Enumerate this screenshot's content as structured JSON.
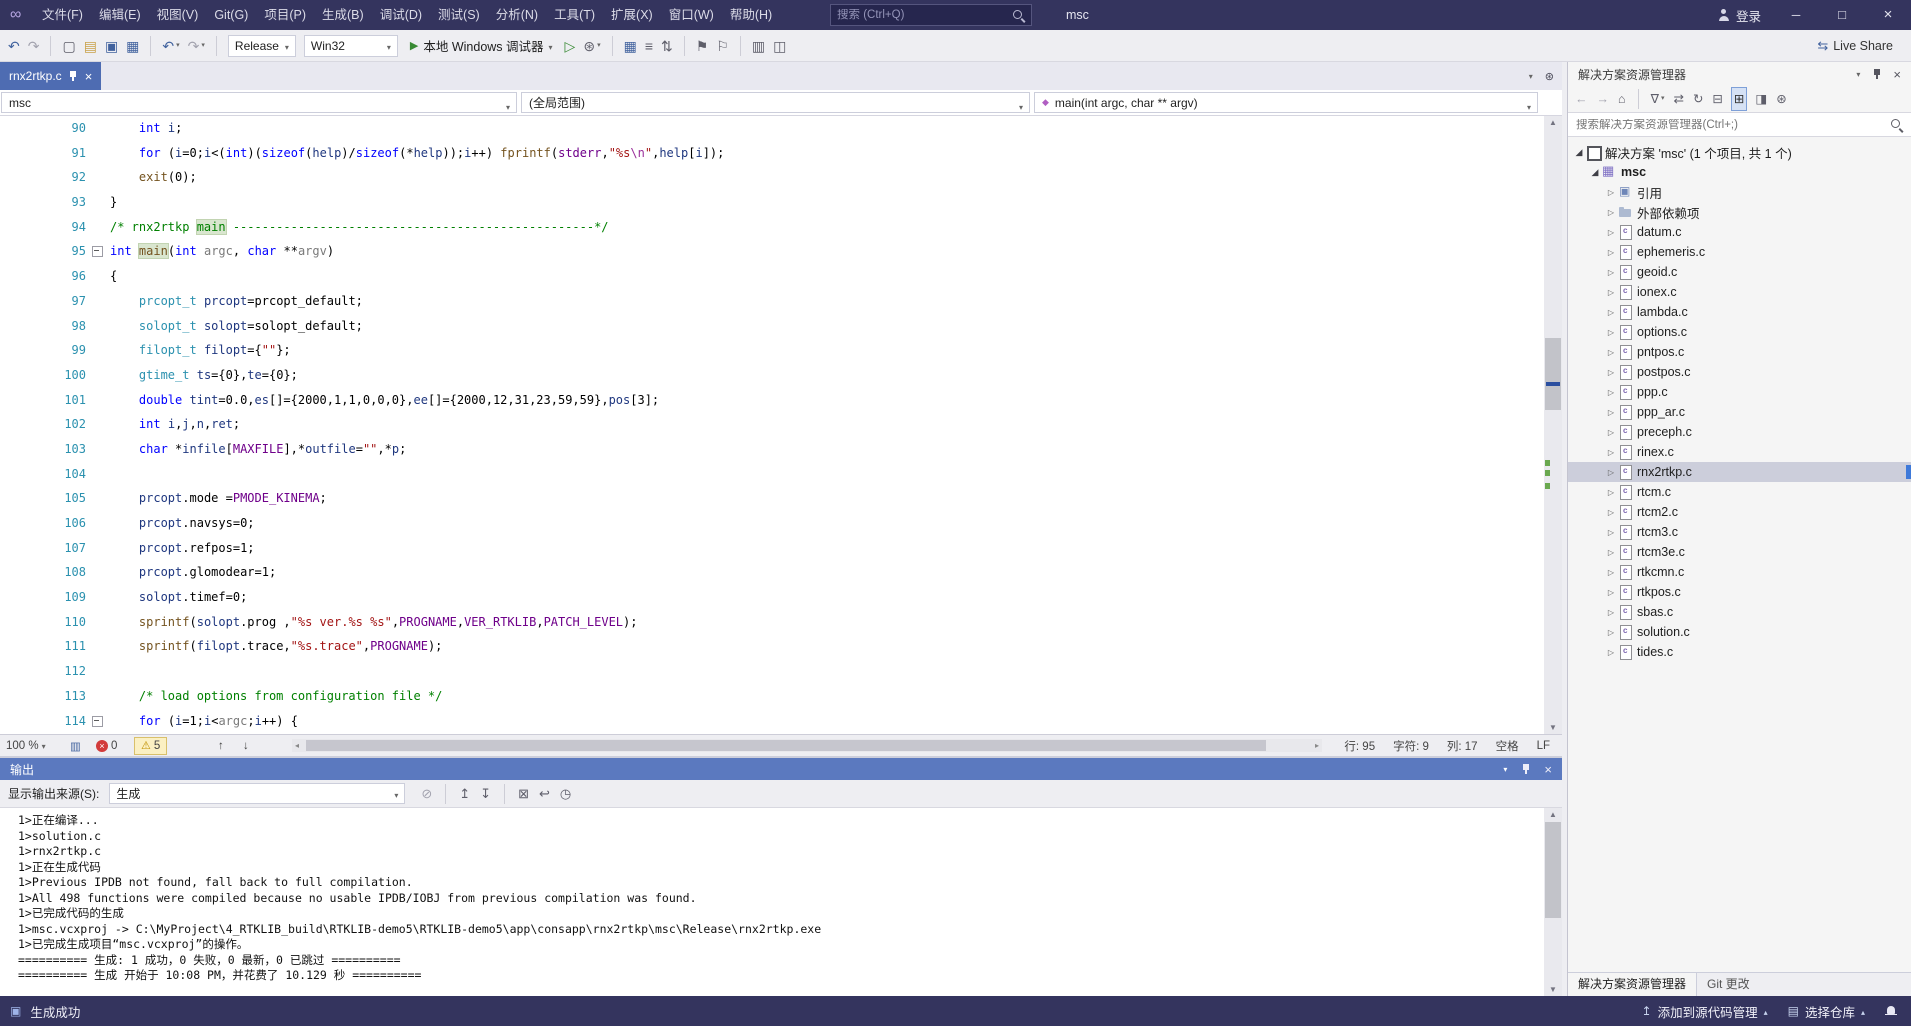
{
  "titlebar": {
    "menus": [
      "文件(F)",
      "编辑(E)",
      "视图(V)",
      "Git(G)",
      "项目(P)",
      "生成(B)",
      "调试(D)",
      "测试(S)",
      "分析(N)",
      "工具(T)",
      "扩展(X)",
      "窗口(W)",
      "帮助(H)"
    ],
    "search_placeholder": "搜索 (Ctrl+Q)",
    "window_title": "msc",
    "sign_in": "登录"
  },
  "toolbar": {
    "live_share": "Live Share",
    "live_share_icon": "⇆",
    "items": [
      {
        "name": "nav-back-icon",
        "g": "↶",
        "cls": "blue"
      },
      {
        "name": "nav-forward-icon",
        "g": "↷",
        "cls": "dim"
      },
      {
        "t": "sep"
      },
      {
        "name": "new-project-icon",
        "g": "▢",
        "cls": "dim2"
      },
      {
        "name": "open-file-icon",
        "g": "▤",
        "cls": "folder"
      },
      {
        "name": "save-icon",
        "g": "▣",
        "cls": "blue"
      },
      {
        "name": "save-all-icon",
        "g": "▦",
        "cls": "blue"
      },
      {
        "t": "sep"
      },
      {
        "name": "undo-icon",
        "g": "↶",
        "cls": "blue",
        "dd": true
      },
      {
        "name": "redo-icon",
        "g": "↷",
        "cls": "dim",
        "dd": true
      },
      {
        "t": "sep"
      },
      {
        "t": "combo",
        "name": "configuration-select",
        "value": "Release",
        "w": 68
      },
      {
        "t": "combo",
        "name": "platform-select",
        "value": "Win32",
        "w": 94
      },
      {
        "t": "debug",
        "name": "start-debug-button",
        "label": "本地 Windows 调试器"
      },
      {
        "name": "start-without-debugging-icon",
        "g": "▷",
        "cls": "green"
      },
      {
        "name": "hot-reload-icon",
        "g": "⊛",
        "cls": "dim2",
        "dd": true
      },
      {
        "t": "sep"
      },
      {
        "name": "build-icon",
        "g": "▦",
        "cls": "blue"
      },
      {
        "name": "outline-icon",
        "g": "≡",
        "cls": "dim2"
      },
      {
        "name": "navigate-lines-icon",
        "g": "⇅",
        "cls": "dim2"
      },
      {
        "t": "sep"
      },
      {
        "name": "bookmark-icon",
        "g": "⚑",
        "cls": "dim2"
      },
      {
        "name": "bookmark-next-icon",
        "g": "⚐",
        "cls": "dim2"
      },
      {
        "t": "sep"
      },
      {
        "name": "find-in-files-icon",
        "g": "▥",
        "cls": "dim2"
      },
      {
        "name": "compare-icon",
        "g": "◫",
        "cls": "dim2"
      }
    ]
  },
  "tabs": {
    "active_label": "rnx2rtkp.c"
  },
  "navbar": {
    "project": "msc",
    "scope": "(全局范围)",
    "member": "main(int argc, char ** argv)"
  },
  "editor": {
    "status": {
      "zoom": "100 %",
      "errors": "0",
      "warnings": "5",
      "line": "行: 95",
      "ch": "字符: 9",
      "col": "列: 17",
      "ws": "空格",
      "eol": "LF"
    },
    "lines": [
      {
        "num": 90,
        "tok": [
          [
            "    ",
            "p"
          ],
          [
            "int",
            "k"
          ],
          [
            " ",
            "p"
          ],
          [
            "i",
            "l"
          ],
          [
            ";",
            "p"
          ]
        ]
      },
      {
        "num": 91,
        "tok": [
          [
            "    ",
            "p"
          ],
          [
            "for",
            "k"
          ],
          [
            " (",
            "p"
          ],
          [
            "i",
            "l"
          ],
          [
            "=0;",
            "p"
          ],
          [
            "i",
            "l"
          ],
          [
            "<(",
            "p"
          ],
          [
            "int",
            "k"
          ],
          [
            ")(",
            "p"
          ],
          [
            "sizeof",
            "k"
          ],
          [
            "(",
            "p"
          ],
          [
            "help",
            "l"
          ],
          [
            ")/",
            "p"
          ],
          [
            "sizeof",
            "k"
          ],
          [
            "(*",
            "p"
          ],
          [
            "help",
            "l"
          ],
          [
            "));",
            "p"
          ],
          [
            "i",
            "l"
          ],
          [
            "++) ",
            "p"
          ],
          [
            "fprintf",
            "f"
          ],
          [
            "(",
            "p"
          ],
          [
            "stderr",
            "m"
          ],
          [
            ",",
            "p"
          ],
          [
            "\"%s",
            "s"
          ],
          [
            "\\n",
            "e"
          ],
          [
            "\"",
            "s"
          ],
          [
            ",",
            "p"
          ],
          [
            "help",
            "l"
          ],
          [
            "[",
            "p"
          ],
          [
            "i",
            "l"
          ],
          [
            "]);",
            "p"
          ]
        ]
      },
      {
        "num": 92,
        "tok": [
          [
            "    ",
            "p"
          ],
          [
            "exit",
            "f"
          ],
          [
            "(0);",
            "p"
          ]
        ]
      },
      {
        "num": 93,
        "tok": [
          [
            "}",
            "p"
          ]
        ]
      },
      {
        "num": 94,
        "tok": [
          [
            "/* rnx2rtkp ",
            "c"
          ],
          [
            "main",
            "ch"
          ],
          [
            " --------------------------------------------------*/",
            "c"
          ]
        ]
      },
      {
        "num": 95,
        "box": true,
        "tok": [
          [
            "int",
            "k"
          ],
          [
            " ",
            "p"
          ],
          [
            "main",
            "fh"
          ],
          [
            "(",
            "p"
          ],
          [
            "int",
            "k"
          ],
          [
            " ",
            "p"
          ],
          [
            "argc",
            "a"
          ],
          [
            ", ",
            "p"
          ],
          [
            "char",
            "k"
          ],
          [
            " **",
            "p"
          ],
          [
            "argv",
            "a"
          ],
          [
            ")",
            "p"
          ]
        ]
      },
      {
        "num": 96,
        "tok": [
          [
            "{",
            "p"
          ]
        ]
      },
      {
        "num": 97,
        "tok": [
          [
            "    ",
            "p"
          ],
          [
            "prcopt_t",
            "t"
          ],
          [
            " ",
            "p"
          ],
          [
            "prcopt",
            "l"
          ],
          [
            "=prcopt_default;",
            "p"
          ]
        ]
      },
      {
        "num": 98,
        "tok": [
          [
            "    ",
            "p"
          ],
          [
            "solopt_t",
            "t"
          ],
          [
            " ",
            "p"
          ],
          [
            "solopt",
            "l"
          ],
          [
            "=solopt_default;",
            "p"
          ]
        ]
      },
      {
        "num": 99,
        "tok": [
          [
            "    ",
            "p"
          ],
          [
            "filopt_t",
            "t"
          ],
          [
            " ",
            "p"
          ],
          [
            "filopt",
            "l"
          ],
          [
            "={",
            "p"
          ],
          [
            "\"\"",
            "s"
          ],
          [
            "};",
            "p"
          ]
        ]
      },
      {
        "num": 100,
        "tok": [
          [
            "    ",
            "p"
          ],
          [
            "gtime_t",
            "t"
          ],
          [
            " ",
            "p"
          ],
          [
            "ts",
            "l"
          ],
          [
            "={0},",
            "p"
          ],
          [
            "te",
            "l"
          ],
          [
            "={0};",
            "p"
          ]
        ]
      },
      {
        "num": 101,
        "tok": [
          [
            "    ",
            "p"
          ],
          [
            "double",
            "k"
          ],
          [
            " ",
            "p"
          ],
          [
            "tint",
            "l"
          ],
          [
            "=0.0,",
            "p"
          ],
          [
            "es",
            "l"
          ],
          [
            "[]={2000,1,1,0,0,0},",
            "p"
          ],
          [
            "ee",
            "l"
          ],
          [
            "[]={2000,12,31,23,59,59},",
            "p"
          ],
          [
            "pos",
            "l"
          ],
          [
            "[3];",
            "p"
          ]
        ]
      },
      {
        "num": 102,
        "tok": [
          [
            "    ",
            "p"
          ],
          [
            "int",
            "k"
          ],
          [
            " ",
            "p"
          ],
          [
            "i",
            "l"
          ],
          [
            ",",
            "p"
          ],
          [
            "j",
            "l"
          ],
          [
            ",",
            "p"
          ],
          [
            "n",
            "l"
          ],
          [
            ",",
            "p"
          ],
          [
            "ret",
            "l"
          ],
          [
            ";",
            "p"
          ]
        ]
      },
      {
        "num": 103,
        "tok": [
          [
            "    ",
            "p"
          ],
          [
            "char",
            "k"
          ],
          [
            " *",
            "p"
          ],
          [
            "infile",
            "l"
          ],
          [
            "[",
            "p"
          ],
          [
            "MAXFILE",
            "m"
          ],
          [
            "],*",
            "p"
          ],
          [
            "outfile",
            "l"
          ],
          [
            "=",
            "p"
          ],
          [
            "\"\"",
            "s"
          ],
          [
            ",*",
            "p"
          ],
          [
            "p",
            "l"
          ],
          [
            ";",
            "p"
          ]
        ]
      },
      {
        "num": 104,
        "tok": []
      },
      {
        "num": 105,
        "tok": [
          [
            "    ",
            "p"
          ],
          [
            "prcopt",
            "l"
          ],
          [
            ".mode =",
            "p"
          ],
          [
            "PMODE_KINEMA",
            "m"
          ],
          [
            ";",
            "p"
          ]
        ]
      },
      {
        "num": 106,
        "tok": [
          [
            "    ",
            "p"
          ],
          [
            "prcopt",
            "l"
          ],
          [
            ".navsys=0;",
            "p"
          ]
        ]
      },
      {
        "num": 107,
        "tok": [
          [
            "    ",
            "p"
          ],
          [
            "prcopt",
            "l"
          ],
          [
            ".refpos=1;",
            "p"
          ]
        ]
      },
      {
        "num": 108,
        "tok": [
          [
            "    ",
            "p"
          ],
          [
            "prcopt",
            "l"
          ],
          [
            ".glomodear=1;",
            "p"
          ]
        ]
      },
      {
        "num": 109,
        "tok": [
          [
            "    ",
            "p"
          ],
          [
            "solopt",
            "l"
          ],
          [
            ".timef=0;",
            "p"
          ]
        ]
      },
      {
        "num": 110,
        "tok": [
          [
            "    ",
            "p"
          ],
          [
            "sprintf",
            "f"
          ],
          [
            "(",
            "p"
          ],
          [
            "solopt",
            "l"
          ],
          [
            ".prog ,",
            "p"
          ],
          [
            "\"%s ver.%s %s\"",
            "s"
          ],
          [
            ",",
            "p"
          ],
          [
            "PROGNAME",
            "m"
          ],
          [
            ",",
            "p"
          ],
          [
            "VER_RTKLIB",
            "m"
          ],
          [
            ",",
            "p"
          ],
          [
            "PATCH_LEVEL",
            "m"
          ],
          [
            ");",
            "p"
          ]
        ]
      },
      {
        "num": 111,
        "tok": [
          [
            "    ",
            "p"
          ],
          [
            "sprintf",
            "f"
          ],
          [
            "(",
            "p"
          ],
          [
            "filopt",
            "l"
          ],
          [
            ".trace,",
            "p"
          ],
          [
            "\"%s.trace\"",
            "s"
          ],
          [
            ",",
            "p"
          ],
          [
            "PROGNAME",
            "m"
          ],
          [
            ");",
            "p"
          ]
        ]
      },
      {
        "num": 112,
        "tok": []
      },
      {
        "num": 113,
        "tok": [
          [
            "    ",
            "p"
          ],
          [
            "/* load options from configuration file */",
            "c"
          ]
        ]
      },
      {
        "num": 114,
        "box": true,
        "tok": [
          [
            "    ",
            "p"
          ],
          [
            "for",
            "k"
          ],
          [
            " (",
            "p"
          ],
          [
            "i",
            "l"
          ],
          [
            "=1;",
            "p"
          ],
          [
            "i",
            "l"
          ],
          [
            "<",
            "p"
          ],
          [
            "argc",
            "a"
          ],
          [
            ";",
            "p"
          ],
          [
            "i",
            "l"
          ],
          [
            "++) {",
            "p"
          ]
        ]
      }
    ]
  },
  "output": {
    "title": "输出",
    "source_label": "显示输出来源(S):",
    "source_value": "生成",
    "icons": [
      {
        "name": "find-message-icon",
        "g": "⊘",
        "cls": "dim"
      },
      {
        "t": "sep"
      },
      {
        "name": "previous-message-icon",
        "g": "↥",
        "cls": "dim2"
      },
      {
        "name": "next-message-icon",
        "g": "↧",
        "cls": "dim2"
      },
      {
        "t": "sep"
      },
      {
        "name": "clear-all-icon",
        "g": "⊠",
        "cls": "dim2"
      },
      {
        "name": "word-wrap-icon",
        "g": "↩",
        "cls": "dim2"
      },
      {
        "name": "timestamp-icon",
        "g": "◷",
        "cls": "dim2"
      }
    ],
    "lines": [
      "1>正在编译...",
      "1>solution.c",
      "1>rnx2rtkp.c",
      "1>正在生成代码",
      "1>Previous IPDB not found, fall back to full compilation.",
      "1>All 498 functions were compiled because no usable IPDB/IOBJ from previous compilation was found.",
      "1>已完成代码的生成",
      "1>msc.vcxproj -> C:\\MyProject\\4_RTKLIB_build\\RTKLIB-demo5\\RTKLIB-demo5\\app\\consapp\\rnx2rtkp\\msc\\Release\\rnx2rtkp.exe",
      "1>已完成生成项目“msc.vcxproj”的操作。",
      "========== 生成: 1 成功，0 失败，0 最新，0 已跳过 ==========",
      "========== 生成 开始于 10:08 PM，并花费了 10.129 秒 =========="
    ]
  },
  "solution_explorer": {
    "title": "解决方案资源管理器",
    "search_placeholder": "搜索解决方案资源管理器(Ctrl+;)",
    "root_label": "解决方案 'msc' (1 个项目, 共 1 个)",
    "project_label": "msc",
    "icons": [
      {
        "name": "back-icon",
        "g": "←",
        "cls": "dim"
      },
      {
        "name": "forward-icon",
        "g": "→",
        "cls": "dim"
      },
      {
        "name": "home-icon",
        "g": "⌂",
        "cls": "dim2"
      },
      {
        "t": "sep"
      },
      {
        "name": "filter-icon",
        "g": "∇",
        "cls": "dim2",
        "dd": true
      },
      {
        "name": "sync-icon",
        "g": "⇄",
        "cls": "dim2"
      },
      {
        "name": "refresh-icon",
        "g": "↻",
        "cls": "dim2"
      },
      {
        "name": "collapse-all-icon",
        "g": "⊟",
        "cls": "dim2"
      },
      {
        "name": "show-all-files-icon",
        "g": "⊞",
        "cls": "pressed"
      },
      {
        "name": "preview-icon",
        "g": "◨",
        "cls": "dim2"
      },
      {
        "name": "properties-icon",
        "g": "⊛",
        "cls": "dim2"
      }
    ],
    "items": [
      {
        "label": "引用",
        "kind": "refs"
      },
      {
        "label": "外部依赖项",
        "kind": "deps"
      },
      {
        "label": "datum.c",
        "kind": "file"
      },
      {
        "label": "ephemeris.c",
        "kind": "file"
      },
      {
        "label": "geoid.c",
        "kind": "file"
      },
      {
        "label": "ionex.c",
        "kind": "file"
      },
      {
        "label": "lambda.c",
        "kind": "file"
      },
      {
        "label": "options.c",
        "kind": "file"
      },
      {
        "label": "pntpos.c",
        "kind": "file"
      },
      {
        "label": "postpos.c",
        "kind": "file"
      },
      {
        "label": "ppp.c",
        "kind": "file"
      },
      {
        "label": "ppp_ar.c",
        "kind": "file"
      },
      {
        "label": "preceph.c",
        "kind": "file"
      },
      {
        "label": "rinex.c",
        "kind": "file"
      },
      {
        "label": "rnx2rtkp.c",
        "kind": "file",
        "selected": true
      },
      {
        "label": "rtcm.c",
        "kind": "file"
      },
      {
        "label": "rtcm2.c",
        "kind": "file"
      },
      {
        "label": "rtcm3.c",
        "kind": "file"
      },
      {
        "label": "rtcm3e.c",
        "kind": "file"
      },
      {
        "label": "rtkcmn.c",
        "kind": "file"
      },
      {
        "label": "rtkpos.c",
        "kind": "file"
      },
      {
        "label": "sbas.c",
        "kind": "file"
      },
      {
        "label": "solution.c",
        "kind": "file"
      },
      {
        "label": "tides.c",
        "kind": "file"
      }
    ],
    "bottom_tabs": [
      "解决方案资源管理器",
      "Git 更改"
    ]
  },
  "statusbar": {
    "message": "生成成功",
    "add_scm": "添加到源代码管理",
    "pick_repo": "选择仓库"
  }
}
